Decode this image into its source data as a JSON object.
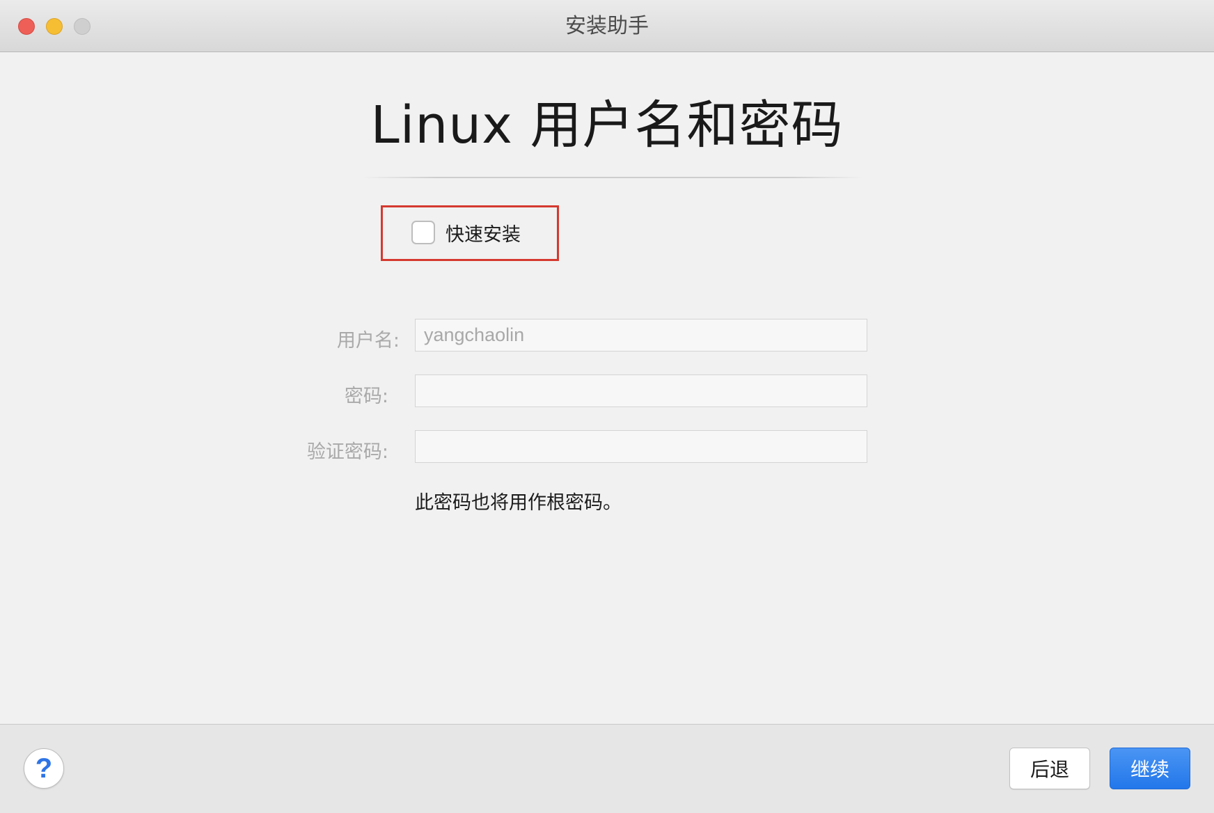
{
  "window": {
    "title": "安装助手"
  },
  "page": {
    "title": "Linux 用户名和密码"
  },
  "quick_install": {
    "label": "快速安装",
    "checked": false,
    "highlight_color": "#d5392f"
  },
  "form": {
    "username_label": "用户名:",
    "username_value": "yangchaolin",
    "password_label": "密码:",
    "password_value": "",
    "confirm_label": "验证密码:",
    "confirm_value": "",
    "hint": "此密码也将用作根密码。"
  },
  "footer": {
    "help_label": "?",
    "back_label": "后退",
    "continue_label": "继续",
    "accent_color": "#2377ea"
  }
}
